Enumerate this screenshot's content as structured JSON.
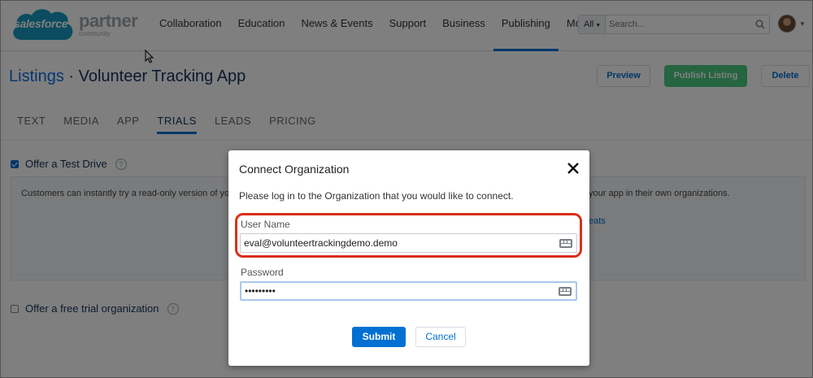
{
  "header": {
    "logo_brand": "salesforce",
    "logo_product": "partner",
    "logo_sub": "community",
    "nav": [
      {
        "label": "Collaboration"
      },
      {
        "label": "Education"
      },
      {
        "label": "News & Events"
      },
      {
        "label": "Support"
      },
      {
        "label": "Business"
      },
      {
        "label": "Publishing",
        "active": true
      },
      {
        "label": "More"
      }
    ],
    "search_scope": "All",
    "search_placeholder": "Search..."
  },
  "page": {
    "breadcrumb": "Listings",
    "separator": "·",
    "title": "Volunteer Tracking App",
    "buttons": {
      "preview": "Preview",
      "publish": "Publish Listing",
      "delete": "Delete"
    },
    "tabs": [
      {
        "label": "TEXT"
      },
      {
        "label": "MEDIA"
      },
      {
        "label": "APP"
      },
      {
        "label": "TRIALS",
        "active": true
      },
      {
        "label": "LEADS"
      },
      {
        "label": "PRICING"
      }
    ],
    "test_drive": {
      "label": "Offer a Test Drive",
      "checked": true,
      "description_left": "Customers can instantly try a read-only version of yo",
      "description_right": "your app in their own organizations.",
      "link_fragment": "eats"
    },
    "free_trial": {
      "label": "Offer a free trial organization",
      "checked": false
    }
  },
  "modal": {
    "title": "Connect Organization",
    "instruction": "Please log in to the Organization that you would like to connect.",
    "username_label": "User Name",
    "username_value": "eval@volunteertrackingdemo.demo",
    "password_label": "Password",
    "password_value": "•••••••••",
    "submit": "Submit",
    "cancel": "Cancel"
  },
  "colors": {
    "brand_blue": "#0070d2",
    "publish_green": "#4bca81",
    "highlight_red": "#d9301c",
    "logo_cloud": "#1798c1"
  }
}
